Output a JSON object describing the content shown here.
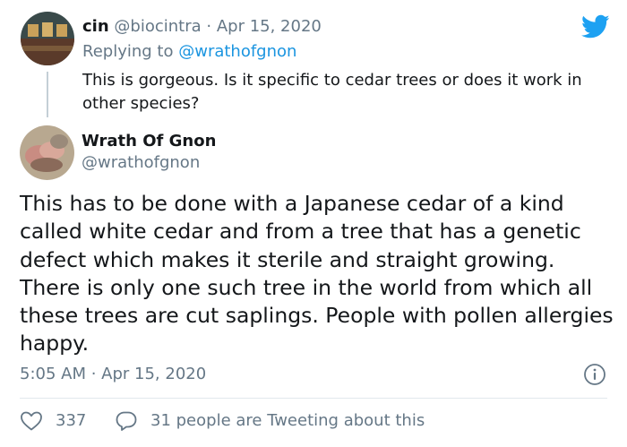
{
  "reply": {
    "avatar": "avatar-cin",
    "name": "cin",
    "handle": "@biocintra",
    "separator": "·",
    "date": "Apr 15, 2020",
    "replying_prefix": "Replying to",
    "replying_to": "@wrathofgnon",
    "text": "This is gorgeous. Is it specific to cedar trees or does it work in other species?"
  },
  "main": {
    "avatar": "avatar-wrath-of-gnon",
    "name": "Wrath Of Gnon",
    "handle": "@wrathofgnon",
    "text": "This has to be done with a Japanese cedar of a kind called white cedar and from a tree that has a genetic defect which makes it sterile and straight growing. There is only one such tree in the world from which all these trees are cut saplings. People with pollen allergies happy.",
    "timestamp": "5:05 AM · Apr 15, 2020"
  },
  "engagement": {
    "likes": "337",
    "comments_text": "31 people are Tweeting about this"
  },
  "icons": {
    "brand": "twitter-bird-icon",
    "info": "info-icon",
    "like": "heart-icon",
    "comment": "comment-bubble-icon"
  },
  "colors": {
    "twitter_blue": "#1da1f2",
    "mention": "#1b95e0",
    "text": "#14171a",
    "muted": "#657786",
    "divider": "#e1e8ed"
  }
}
